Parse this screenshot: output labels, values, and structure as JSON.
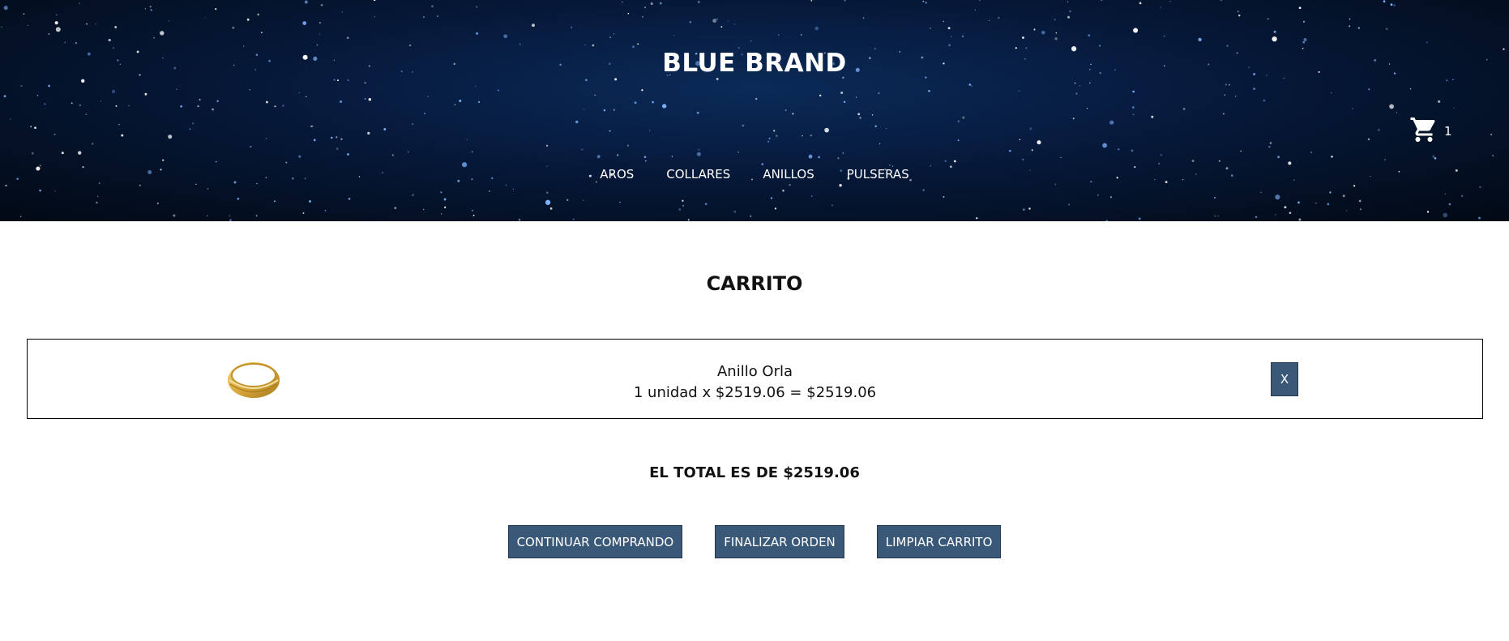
{
  "header": {
    "brand": "BLUE BRAND",
    "cart_count": "1",
    "nav": [
      "AROS",
      "COLLARES",
      "ANILLOS",
      "PULSERAS"
    ]
  },
  "main": {
    "title": "CARRITO",
    "items": [
      {
        "name": "Anillo Orla",
        "line": "1 unidad x $2519.06 = $2519.06",
        "remove_label": "X"
      }
    ],
    "total": "EL TOTAL ES DE $2519.06",
    "buttons": {
      "continue": "CONTINUAR COMPRANDO",
      "checkout": "FINALIZAR ORDEN",
      "clear": "LIMPIAR CARRITO"
    }
  },
  "colors": {
    "button_bg": "#3a5878",
    "hero_bg": "#06193a"
  },
  "icons": {
    "cart": "cart-icon",
    "product": "ring-image"
  }
}
